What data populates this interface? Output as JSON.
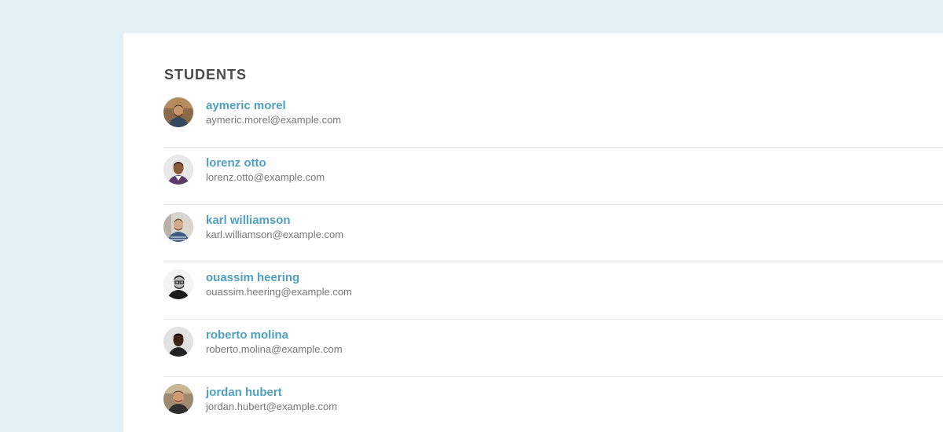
{
  "page": {
    "background": "#e3f0f5",
    "card_background": "#ffffff"
  },
  "section": {
    "title": "STUDENTS",
    "link_color": "#4f9fc0"
  },
  "students": [
    {
      "name": "aymeric morel",
      "email": "aymeric.morel@example.com",
      "avatar": "avatar-aymeric-morel"
    },
    {
      "name": "lorenz otto",
      "email": "lorenz.otto@example.com",
      "avatar": "avatar-lorenz-otto"
    },
    {
      "name": "karl williamson",
      "email": "karl.williamson@example.com",
      "avatar": "avatar-karl-williamson"
    },
    {
      "name": "ouassim heering",
      "email": "ouassim.heering@example.com",
      "avatar": "avatar-ouassim-heering"
    },
    {
      "name": "roberto molina",
      "email": "roberto.molina@example.com",
      "avatar": "avatar-roberto-molina"
    },
    {
      "name": "jordan hubert",
      "email": "jordan.hubert@example.com",
      "avatar": "avatar-jordan-hubert"
    }
  ]
}
